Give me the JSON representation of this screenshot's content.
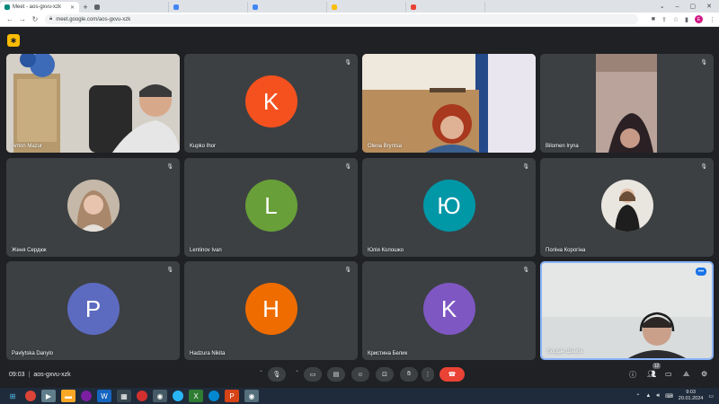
{
  "browser": {
    "active_tab_title": "Meet - aos-gxvu-xzk",
    "url": "meet.google.com/aos-gxvu-xzk",
    "profile_initial": "E"
  },
  "meeting": {
    "time": "09:03",
    "code": "aos-gxvu-xzk",
    "participant_count_badge": "12"
  },
  "participants": [
    {
      "name": "Anton Mazur",
      "type": "video"
    },
    {
      "name": "Kupko Ihor",
      "type": "initial",
      "initial": "K",
      "color": "#f4511e"
    },
    {
      "name": "Olena Bryntsa",
      "type": "video"
    },
    {
      "name": "Bilomen Iryna",
      "type": "video"
    },
    {
      "name": "Жeня Сердюк",
      "type": "photo"
    },
    {
      "name": "Lentinov Ivan",
      "type": "initial",
      "initial": "L",
      "color": "#689f38"
    },
    {
      "name": "Юлія Колошко",
      "type": "initial",
      "initial": "Ю",
      "color": "#0097a7"
    },
    {
      "name": "Поліна Корогіна",
      "type": "photo"
    },
    {
      "name": "Pavlytska Danylo",
      "type": "initial",
      "initial": "P",
      "color": "#5c6bc0"
    },
    {
      "name": "Hadzura Nikita",
      "type": "initial",
      "initial": "H",
      "color": "#ef6c00"
    },
    {
      "name": "Кристина Белик",
      "type": "initial",
      "initial": "K",
      "color": "#7e57c2"
    },
    {
      "name": "Богдан Шевба",
      "type": "video"
    }
  ],
  "icons": {
    "mic_off": "mic-off-icon",
    "mic": "mic-icon",
    "camera": "camera-icon",
    "captions": "captions-icon",
    "emoji": "emoji-icon",
    "present": "present-icon",
    "hand": "raise-hand-icon",
    "more": "more-vert-icon",
    "end_call": "end-call-icon",
    "info": "info-icon",
    "people": "people-icon",
    "chat": "chat-icon",
    "activities": "activities-icon",
    "host": "host-controls-icon"
  },
  "colors": {
    "meet_bg": "#202124",
    "tile_bg": "#3c4043",
    "end_call": "#ea4335",
    "active_speaker_border": "#8ab4f8"
  },
  "taskbar": {
    "time": "9:03",
    "date": "20.01.2024"
  }
}
